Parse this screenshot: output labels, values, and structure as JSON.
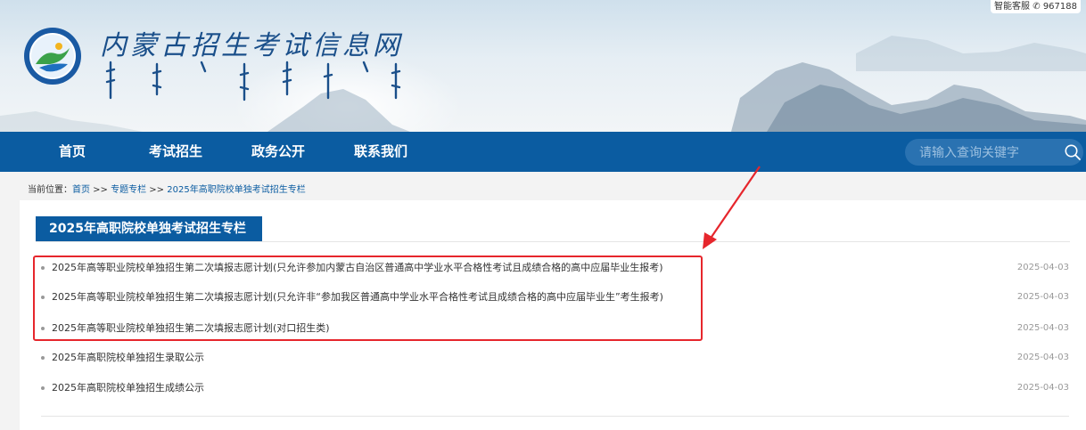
{
  "header": {
    "site_title": "内蒙古招生考试信息网",
    "service_label": "智能客服",
    "service_number": "967188"
  },
  "nav": {
    "items": [
      {
        "label": "首页"
      },
      {
        "label": "考试招生"
      },
      {
        "label": "政务公开"
      },
      {
        "label": "联系我们"
      }
    ],
    "search_placeholder": "请输入查询关键字",
    "search_icon": "search-icon"
  },
  "breadcrumb": {
    "prefix": "当前位置：",
    "items": [
      "首页",
      "专题专栏",
      "2025年高职院校单独考试招生专栏"
    ],
    "separator": " >> "
  },
  "section": {
    "title": "2025年高职院校单独考试招生专栏",
    "articles": [
      {
        "title": "2025年高等职业院校单独招生第二次填报志愿计划(只允许参加内蒙古自治区普通高中学业水平合格性考试且成绩合格的高中应届毕业生报考)",
        "date": "2025-04-03"
      },
      {
        "title": "2025年高等职业院校单独招生第二次填报志愿计划(只允许非“参加我区普通高中学业水平合格性考试且成绩合格的高中应届毕业生”考生报考)",
        "date": "2025-04-03"
      },
      {
        "title": "2025年高等职业院校单独招生第二次填报志愿计划(对口招生类)",
        "date": "2025-04-03"
      },
      {
        "title": "2025年高职院校单独招生录取公示",
        "date": "2025-04-03"
      },
      {
        "title": "2025年高职院校单独招生成绩公示",
        "date": "2025-04-03"
      }
    ]
  },
  "colors": {
    "nav_blue": "#0b5ca1",
    "highlight_red": "#e6262c"
  }
}
